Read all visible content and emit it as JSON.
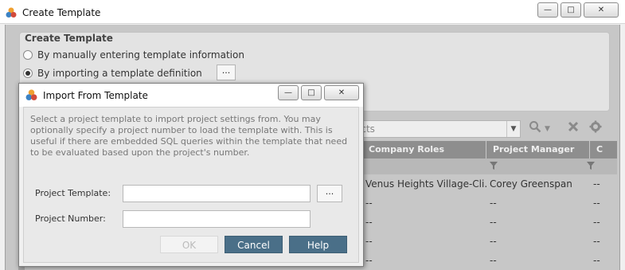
{
  "main_window": {
    "title": "Create Template",
    "group_title": "Create Template",
    "option_manual": "By manually entering template information",
    "option_import": "By importing a template definition",
    "browse_label": "...",
    "search_placeholder": "ects",
    "grid": {
      "columns": [
        "Company Roles",
        "Project Manager",
        "C"
      ],
      "rows": [
        [
          "Venus Heights Village-Cli...",
          "Corey Greenspan",
          "--"
        ],
        [
          "--",
          "--",
          "--"
        ],
        [
          "--",
          "--",
          "--"
        ],
        [
          "--",
          "--",
          "--"
        ],
        [
          "--",
          "--",
          "--"
        ]
      ]
    }
  },
  "dialog": {
    "title": "Import From Template",
    "description": "Select a project template to import project settings from. You may optionally specify a project number to load the template with. This is useful if there are embedded SQL queries within the template that need to be evaluated based upon the project's number.",
    "project_template_label": "Project Template:",
    "project_template_value": "",
    "browse_label": "...",
    "project_number_label": "Project Number:",
    "project_number_value": "",
    "ok_label": "OK",
    "cancel_label": "Cancel",
    "help_label": "Help"
  },
  "window_controls": {
    "minimize": "—",
    "maximize": "□",
    "close": "✕"
  },
  "colors": {
    "accent_button": "#4a6f88",
    "grid_header": "#8e8e8e"
  },
  "icons": [
    "app-icon",
    "search-icon",
    "clear-icon",
    "gear-icon",
    "funnel-icon",
    "dropdown-arrow-icon"
  ]
}
